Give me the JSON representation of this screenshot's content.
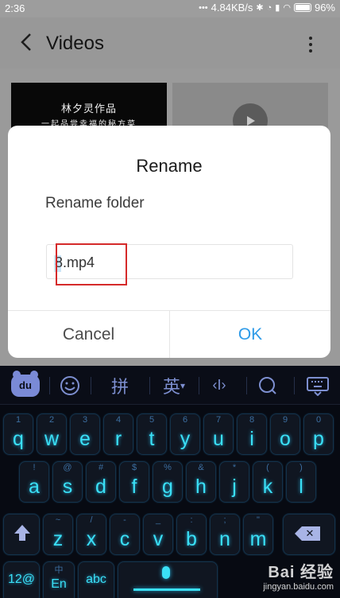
{
  "status_bar": {
    "time": "2:36",
    "network_speed": "4.84KB/s",
    "battery": "96%",
    "icons": [
      "dots-icon",
      "bluetooth-icon",
      "alarm-icon",
      "signal-icon",
      "wifi-icon",
      "battery-icon"
    ]
  },
  "header": {
    "title": "Videos",
    "back_icon": "back-arrow-icon",
    "more_icon": "more-vert-icon"
  },
  "content": {
    "thumb1_line1": "林夕灵作品",
    "thumb1_line2": "一起品尝幸福的秘方菜",
    "thumb2_icon": "play-icon"
  },
  "dialog": {
    "title": "Rename",
    "label": "Rename folder",
    "input_value": "8.mp4",
    "cancel_label": "Cancel",
    "ok_label": "OK",
    "accent_color": "#2e9be8"
  },
  "keyboard": {
    "toolbar": {
      "logo_text": "du",
      "pinyin": "拼",
      "english": "英",
      "english_caret": "▾",
      "cursor_label": "‹I›"
    },
    "row1": [
      {
        "char": "q",
        "sub": "1"
      },
      {
        "char": "w",
        "sub": "2"
      },
      {
        "char": "e",
        "sub": "3"
      },
      {
        "char": "r",
        "sub": "4"
      },
      {
        "char": "t",
        "sub": "5"
      },
      {
        "char": "y",
        "sub": "6"
      },
      {
        "char": "u",
        "sub": "7"
      },
      {
        "char": "i",
        "sub": "8"
      },
      {
        "char": "o",
        "sub": "9"
      },
      {
        "char": "p",
        "sub": "0"
      }
    ],
    "row2": [
      {
        "char": "a",
        "sub": "!"
      },
      {
        "char": "s",
        "sub": "@"
      },
      {
        "char": "d",
        "sub": "#"
      },
      {
        "char": "f",
        "sub": "$"
      },
      {
        "char": "g",
        "sub": "%"
      },
      {
        "char": "h",
        "sub": "&"
      },
      {
        "char": "j",
        "sub": "*"
      },
      {
        "char": "k",
        "sub": "("
      },
      {
        "char": "l",
        "sub": ")"
      }
    ],
    "row3": [
      {
        "char": "z",
        "sub": "~"
      },
      {
        "char": "x",
        "sub": "/"
      },
      {
        "char": "c",
        "sub": "-"
      },
      {
        "char": "v",
        "sub": "_"
      },
      {
        "char": "b",
        "sub": ":"
      },
      {
        "char": "n",
        "sub": ";"
      },
      {
        "char": "m",
        "sub": "\""
      }
    ],
    "bottom": {
      "symbols_label": "12@",
      "lang_sub": "中",
      "lang_label": "En",
      "abc_label": "abc"
    },
    "key_glow_color": "#3ae0f6"
  },
  "watermark": {
    "brand": "Bai 经验",
    "url": "jingyan.baidu.com"
  }
}
